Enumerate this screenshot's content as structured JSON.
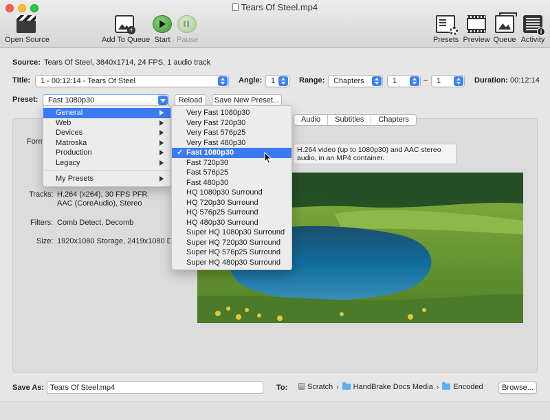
{
  "window": {
    "title": "Tears Of Steel.mp4"
  },
  "toolbar": {
    "open_source": "Open Source",
    "add_to_queue": "Add To Queue",
    "start": "Start",
    "pause": "Pause",
    "presets": "Presets",
    "preview": "Preview",
    "queue": "Queue",
    "activity": "Activity"
  },
  "source": {
    "label": "Source:",
    "value": "Tears Of Steel, 3840x1714, 24 FPS, 1 audio track"
  },
  "title_row": {
    "title_label": "Title:",
    "title_value": "1 - 00:12:14 - Tears Of Steel",
    "angle_label": "Angle:",
    "angle_value": "1",
    "range_label": "Range:",
    "range_type": "Chapters",
    "range_start": "1",
    "range_dash": "–",
    "range_end": "1",
    "duration_label": "Duration:",
    "duration_value": "00:12:14"
  },
  "preset_row": {
    "label": "Preset:",
    "value": "Fast 1080p30",
    "reload": "Reload",
    "save_new": "Save New Preset..."
  },
  "tabs": [
    "Audio",
    "Subtitles",
    "Chapters"
  ],
  "summary": {
    "format_label": "Form",
    "tracks_label": "Tracks:",
    "tracks_line1": "H.264 (x264), 30 FPS PFR",
    "tracks_line2": "AAC (CoreAudio), Stereo",
    "filters_label": "Filters:",
    "filters_value": "Comb Detect, Decomb",
    "size_label": "Size:",
    "size_value": "1920x1080 Storage, 2419x1080 Dis"
  },
  "category_menu": {
    "items": [
      "General",
      "Web",
      "Devices",
      "Matroska",
      "Production",
      "Legacy"
    ],
    "my_presets": "My Presets"
  },
  "preset_menu": {
    "items": [
      "Very Fast 1080p30",
      "Very Fast 720p30",
      "Very Fast 576p25",
      "Very Fast 480p30",
      "Fast 1080p30",
      "Fast 720p30",
      "Fast 576p25",
      "Fast 480p30",
      "HQ 1080p30 Surround",
      "HQ 720p30 Surround",
      "HQ 576p25 Surround",
      "HQ 480p30 Surround",
      "Super HQ 1080p30 Surround",
      "Super HQ 720p30 Surround",
      "Super HQ 576p25 Surround",
      "Super HQ 480p30 Surround"
    ],
    "checkmark": "✓"
  },
  "tooltip": {
    "line1": "H.264 video (up to 1080p30) and AAC stereo",
    "line2": "audio, in an MP4 container."
  },
  "save_row": {
    "label": "Save As:",
    "filename": "Tears Of Steel.mp4",
    "to_label": "To:",
    "path": [
      "Scratch",
      "HandBrake Docs Media",
      "Encoded"
    ],
    "browse": "Browse..."
  },
  "colors": {
    "accent": "#3a7bf2",
    "start_green": "#3c9a35"
  }
}
